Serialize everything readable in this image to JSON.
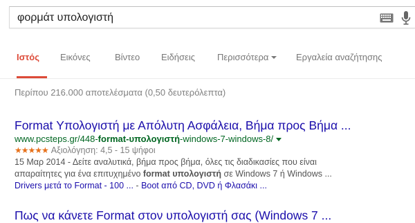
{
  "search": {
    "query": "φορμάτ υπολογιστή"
  },
  "tabs": [
    {
      "label": "Ιστός",
      "active": true
    },
    {
      "label": "Εικόνες"
    },
    {
      "label": "Βίντεο"
    },
    {
      "label": "Ειδήσεις"
    },
    {
      "label": "Περισσότερα"
    },
    {
      "label": "Εργαλεία αναζήτησης"
    }
  ],
  "stats": "Περίπου 216.000 αποτελέσματα (0,50 δευτερόλεπτα)",
  "results": [
    {
      "title": "Format Υπολογιστή με Απόλυτη Ασφάλεια, Βήμα προς Βήμα ...",
      "url_prefix": "www.pcsteps.gr/448-",
      "url_bold": "format-υπολογιστή",
      "url_suffix": "-windows-7-windows-8/",
      "stars": "★★★★★",
      "rating_prefix": "Αξιολόγηση:",
      "rating": "4,5 - 15 ψήφοι",
      "snippet_date": "15 Μαρ 2014 - ",
      "snippet_line1": "Δείτε αναλυτικά, βήμα προς βήμα, όλες τις διαδικασίες που είναι",
      "snippet_line2_pre": "απαραίτητες για ένα επιτυχημένο ",
      "snippet_line2_bold": "format υπολογιστή",
      "snippet_line2_post": " σε Windows 7 ή Windows ...",
      "sitelinks": [
        "Drivers μετά το Format - 100 ...",
        "Boot από CD, DVD ή Φλασάκι ..."
      ]
    },
    {
      "title": "Πως να κάνετε Format στον υπολογιστή σας (Windows 7 ..."
    }
  ],
  "colors": {
    "link": "#1a0dab",
    "url": "#006621",
    "active_tab": "#dd4b39",
    "stars": "#e7711b"
  },
  "icons": {
    "keyboard": "keyboard-icon",
    "mic": "microphone-icon",
    "dropdown": "caret-down-icon"
  }
}
